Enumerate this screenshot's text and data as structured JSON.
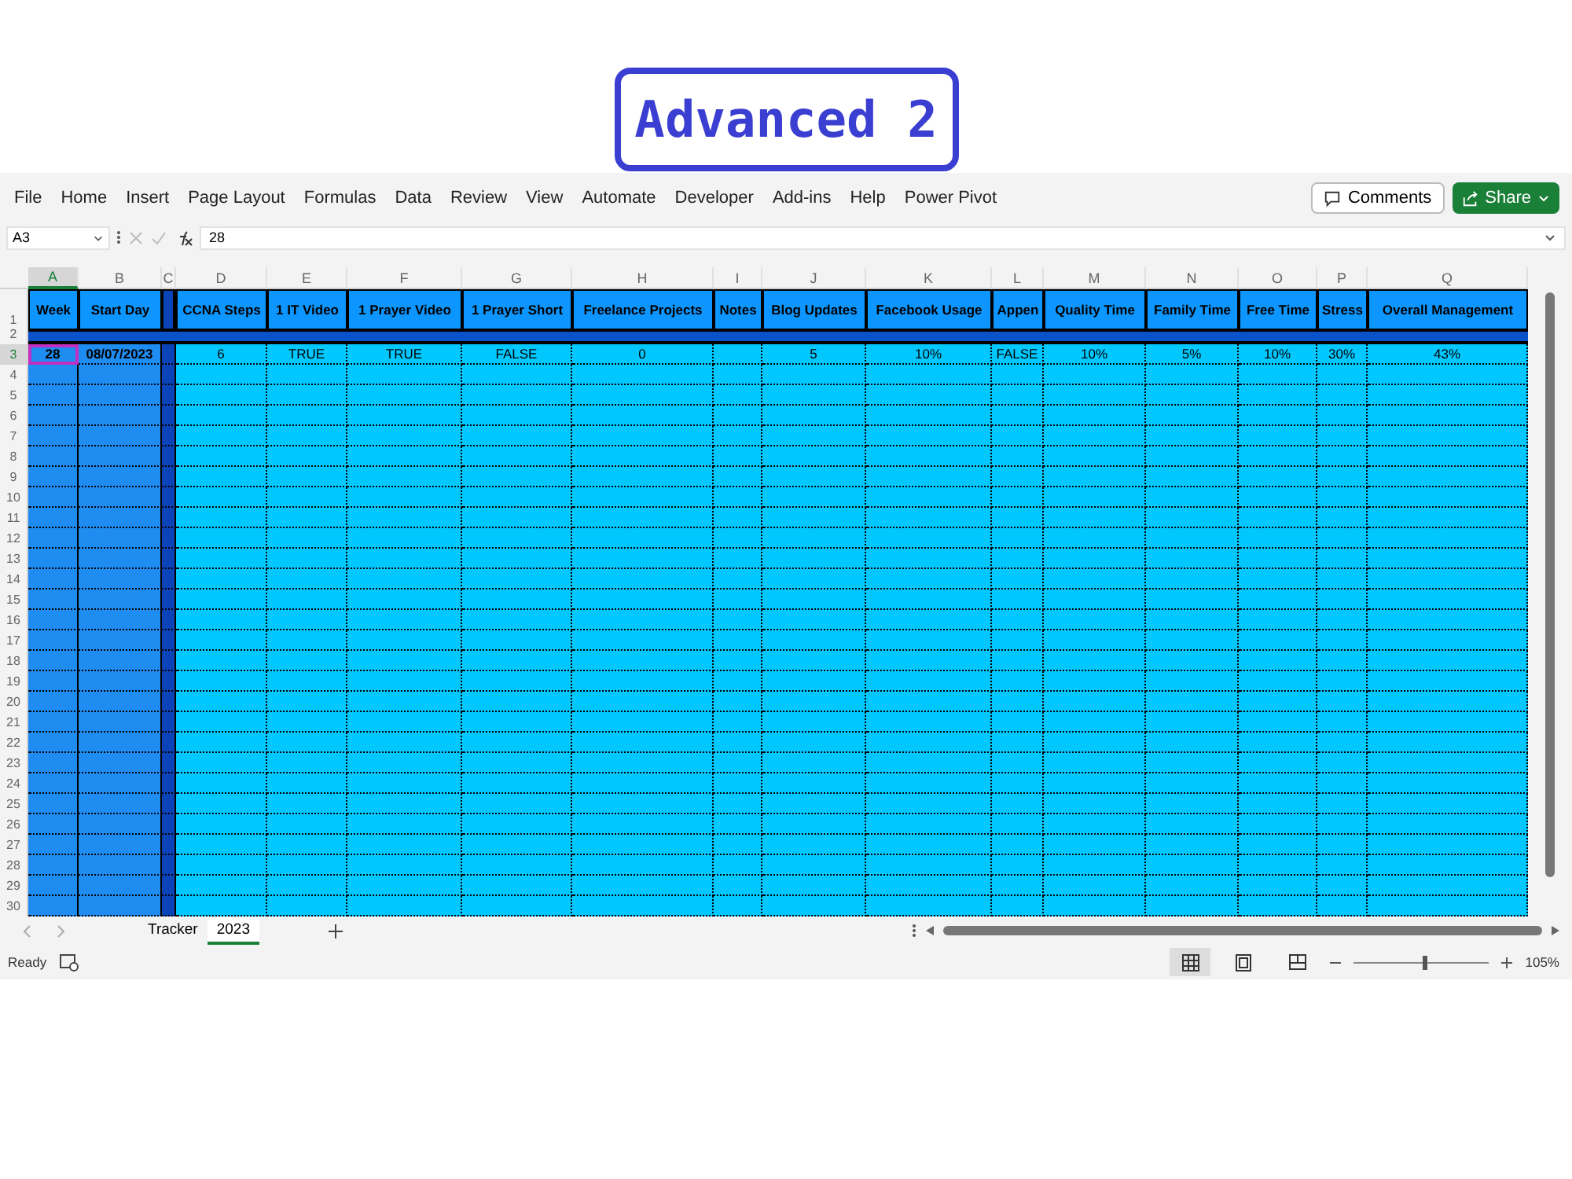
{
  "banner": {
    "title": "Advanced 2"
  },
  "menu": [
    {
      "label": "File"
    },
    {
      "label": "Home"
    },
    {
      "label": "Insert"
    },
    {
      "label": "Page Layout"
    },
    {
      "label": "Formulas"
    },
    {
      "label": "Data"
    },
    {
      "label": "Review"
    },
    {
      "label": "View"
    },
    {
      "label": "Automate"
    },
    {
      "label": "Developer"
    },
    {
      "label": "Add-ins"
    },
    {
      "label": "Help"
    },
    {
      "label": "Power Pivot"
    }
  ],
  "actions": {
    "comments": "Comments",
    "share": "Share"
  },
  "formula_bar": {
    "name_box": "A3",
    "formula": "28"
  },
  "columns": [
    {
      "letter": "A",
      "header": "Week",
      "value": "28",
      "kind": "key",
      "selected": true
    },
    {
      "letter": "B",
      "header": "Start Day",
      "value": "08/07/2023",
      "kind": "key",
      "selected": false
    },
    {
      "letter": "C",
      "kind": "divider",
      "selected": false
    },
    {
      "letter": "D",
      "header": "CCNA Steps",
      "value": "6",
      "kind": "data",
      "selected": false
    },
    {
      "letter": "E",
      "header": "1 IT Video",
      "value": "TRUE",
      "kind": "data",
      "selected": false
    },
    {
      "letter": "F",
      "header": "1 Prayer Video",
      "value": "TRUE",
      "kind": "data",
      "selected": false
    },
    {
      "letter": "G",
      "header": "1 Prayer Short",
      "value": "FALSE",
      "kind": "data",
      "selected": false
    },
    {
      "letter": "H",
      "header": "Freelance Projects",
      "value": "0",
      "kind": "data",
      "selected": false
    },
    {
      "letter": "I",
      "header": "Notes",
      "kind": "data",
      "selected": false
    },
    {
      "letter": "J",
      "header": "Blog Updates",
      "value": "5",
      "kind": "data",
      "selected": false
    },
    {
      "letter": "K",
      "header": "Facebook Usage",
      "value": "10%",
      "kind": "data",
      "selected": false
    },
    {
      "letter": "L",
      "header": "Appen",
      "value": "FALSE",
      "kind": "data",
      "selected": false
    },
    {
      "letter": "M",
      "header": "Quality Time",
      "value": "10%",
      "kind": "data",
      "selected": false
    },
    {
      "letter": "N",
      "header": "Family Time",
      "value": "5%",
      "kind": "data",
      "selected": false
    },
    {
      "letter": "O",
      "header": "Free Time",
      "value": "10%",
      "kind": "data",
      "selected": false
    },
    {
      "letter": "P",
      "header": "Stress",
      "value": "30%",
      "kind": "data",
      "selected": false
    },
    {
      "letter": "Q",
      "header": "Overall Management",
      "value": "43%",
      "kind": "data",
      "selected": false
    }
  ],
  "rows": [
    {
      "label": "1",
      "selected": false
    },
    {
      "label": "2",
      "selected": false
    },
    {
      "label": "3",
      "selected": true
    },
    {
      "label": "4",
      "selected": false
    },
    {
      "label": "5",
      "selected": false
    },
    {
      "label": "6",
      "selected": false
    },
    {
      "label": "7",
      "selected": false
    },
    {
      "label": "8",
      "selected": false
    },
    {
      "label": "9",
      "selected": false
    },
    {
      "label": "10",
      "selected": false
    },
    {
      "label": "11",
      "selected": false
    },
    {
      "label": "12",
      "selected": false
    },
    {
      "label": "13",
      "selected": false
    },
    {
      "label": "14",
      "selected": false
    },
    {
      "label": "15",
      "selected": false
    },
    {
      "label": "16",
      "selected": false
    },
    {
      "label": "17",
      "selected": false
    },
    {
      "label": "18",
      "selected": false
    },
    {
      "label": "19",
      "selected": false
    },
    {
      "label": "20",
      "selected": false
    },
    {
      "label": "21",
      "selected": false
    },
    {
      "label": "22",
      "selected": false
    },
    {
      "label": "23",
      "selected": false
    },
    {
      "label": "24",
      "selected": false
    },
    {
      "label": "25",
      "selected": false
    },
    {
      "label": "26",
      "selected": false
    },
    {
      "label": "27",
      "selected": false
    },
    {
      "label": "28",
      "selected": false
    },
    {
      "label": "29",
      "selected": false
    },
    {
      "label": "30",
      "selected": false
    }
  ],
  "sheet_tabs": [
    {
      "label": "Tracker",
      "selected": false
    },
    {
      "label": "2023",
      "selected": true
    }
  ],
  "status_bar": {
    "status": "Ready",
    "zoom": "105%",
    "zoom_slider": {
      "level": 0.52
    }
  }
}
